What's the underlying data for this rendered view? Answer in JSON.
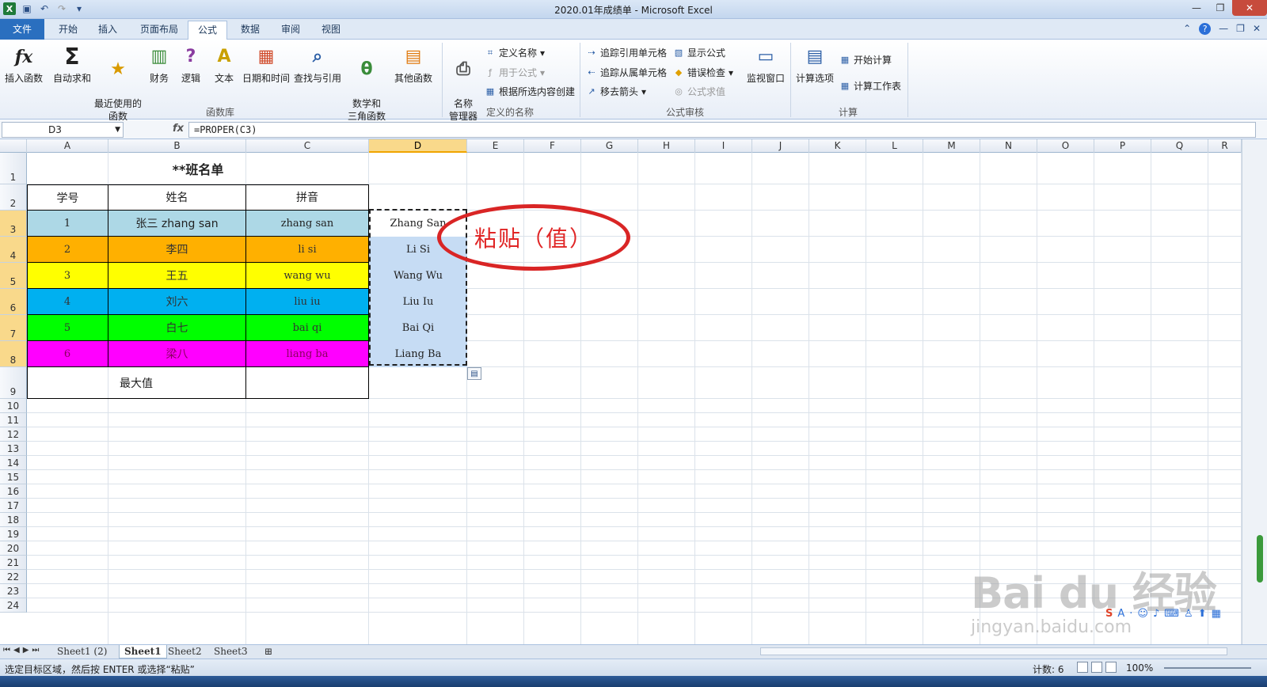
{
  "window": {
    "title": "2020.01年成绩单 - Microsoft Excel",
    "quick_access": [
      "excel-logo-icon",
      "save-icon",
      "undo-icon",
      "redo-icon",
      "customize-icon"
    ]
  },
  "ribbon_tabs": [
    "文件",
    "开始",
    "插入",
    "页面布局",
    "公式",
    "数据",
    "审阅",
    "视图"
  ],
  "active_tab": "公式",
  "ribbon": {
    "function_library": {
      "label": "函数库",
      "buttons": [
        "插入函数",
        "自动求和",
        "最近使用的\n函数",
        "财务",
        "逻辑",
        "文本",
        "日期和时间",
        "查找与引用",
        "数学和\n三角函数",
        "其他函数"
      ]
    },
    "defined_names": {
      "label": "定义的名称",
      "manager": "名称\n管理器",
      "items": [
        "定义名称",
        "用于公式",
        "根据所选内容创建"
      ]
    },
    "formula_auditing": {
      "label": "公式审核",
      "items": [
        "追踪引用单元格",
        "追踪从属单元格",
        "移去箭头",
        "显示公式",
        "错误检查",
        "公式求值"
      ],
      "watch": "监视窗口"
    },
    "calculation": {
      "label": "计算",
      "options": "计算选项",
      "items": [
        "开始计算",
        "计算工作表"
      ]
    }
  },
  "formula_bar": {
    "name_box": "D3",
    "fx": "fx",
    "formula": "=PROPER(C3)"
  },
  "columns": [
    "A",
    "B",
    "C",
    "D",
    "E",
    "F",
    "G",
    "H",
    "I",
    "J",
    "K",
    "L",
    "M",
    "N",
    "O",
    "P",
    "Q",
    "R"
  ],
  "selected_column": "D",
  "rows": [
    "1",
    "2",
    "3",
    "4",
    "5",
    "6",
    "7",
    "8",
    "9",
    "10",
    "11",
    "12",
    "13",
    "14",
    "15",
    "16",
    "17",
    "18",
    "19",
    "20",
    "21",
    "22",
    "23",
    "24"
  ],
  "sheet": {
    "title": "**班名单",
    "headers": [
      "学号",
      "姓名",
      "拼音"
    ],
    "records": [
      {
        "id": "1",
        "name": "张三 zhang san",
        "pinyin": "zhang san",
        "proper": "Zhang San",
        "color": "#add8e6"
      },
      {
        "id": "2",
        "name": "李四",
        "pinyin": "li si",
        "proper": "Li Si",
        "color": "#ffb000"
      },
      {
        "id": "3",
        "name": "王五",
        "pinyin": "wang wu",
        "proper": "Wang Wu",
        "color": "#ffff00"
      },
      {
        "id": "4",
        "name": "刘六",
        "pinyin": "liu iu",
        "proper": "Liu Iu",
        "color": "#00b0f0"
      },
      {
        "id": "5",
        "name": "白七",
        "pinyin": "bai qi",
        "proper": "Bai Qi",
        "color": "#00ff00"
      },
      {
        "id": "6",
        "name": "梁八",
        "pinyin": "liang ba",
        "proper": "Liang Ba",
        "color": "#ff00ff"
      }
    ],
    "max_label": "最大值"
  },
  "annotation": "粘贴（值）",
  "sheet_tabs": [
    "Sheet1 (2)",
    "Sheet1",
    "Sheet2",
    "Sheet3"
  ],
  "active_sheet": "Sheet1",
  "status": {
    "message": "选定目标区域，然后按 ENTER 或选择“粘贴”",
    "count": "计数: 6",
    "zoom": "100%"
  },
  "watermark": {
    "brand": "Bai du 经验",
    "url": "jingyan.baidu.com"
  }
}
